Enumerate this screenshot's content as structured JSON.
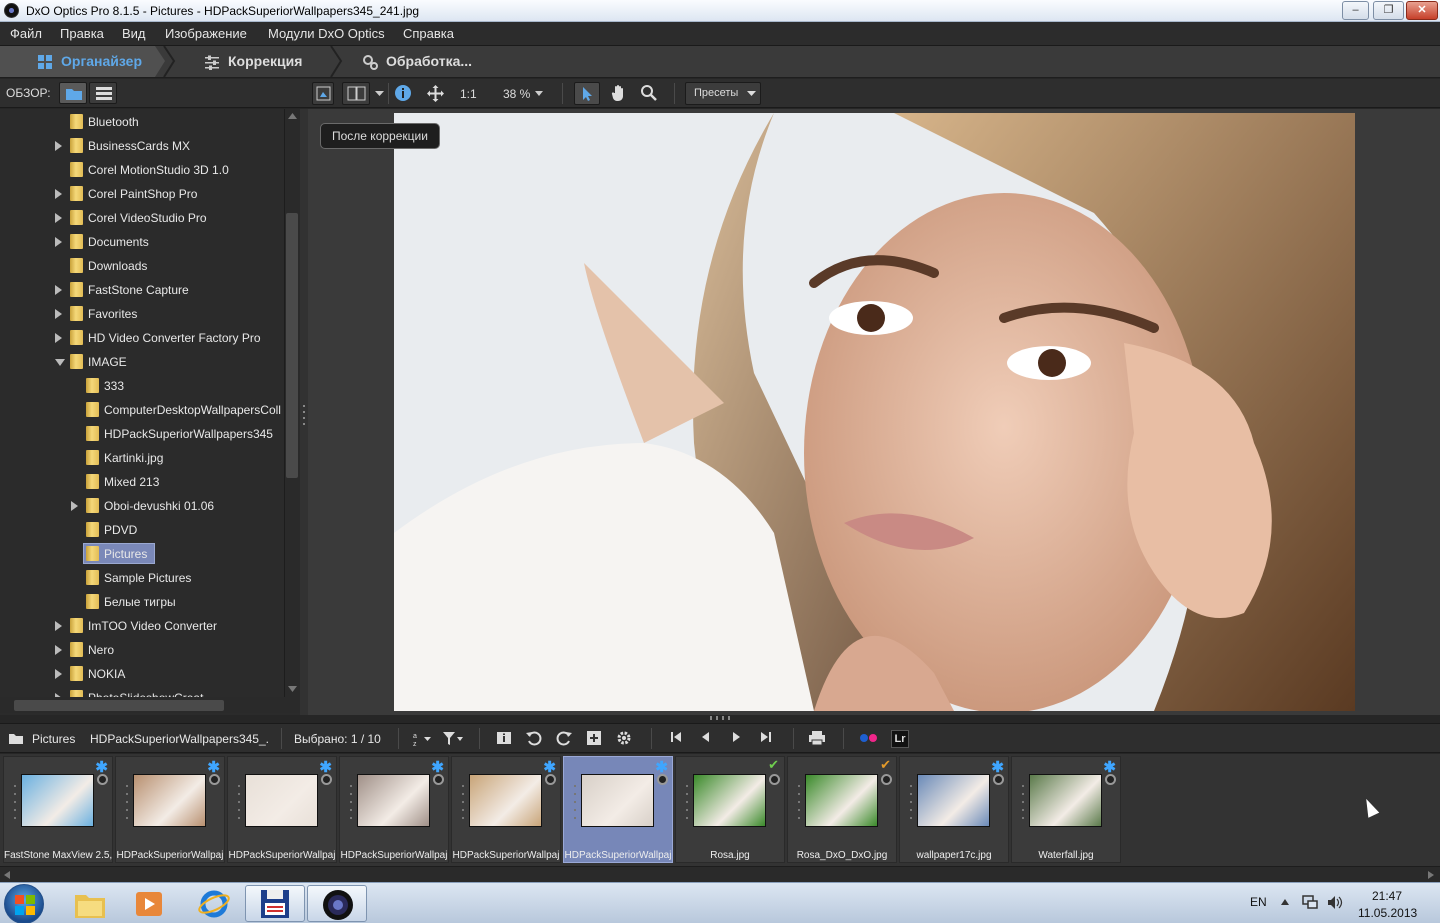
{
  "window": {
    "title": "DxO Optics Pro 8.1.5 - Pictures - HDPackSuperiorWallpapers345_241.jpg",
    "min": "–",
    "max": "❐",
    "close": "✕"
  },
  "menu": [
    "Файл",
    "Правка",
    "Вид",
    "Изображение",
    "Модули DxO Optics",
    "Справка"
  ],
  "tabs": {
    "organizer": "Органайзер",
    "correction": "Коррекция",
    "processing": "Обработка..."
  },
  "browse_label": "ОБЗОР:",
  "viewbar": {
    "one_to_one": "1:1",
    "zoom": "38 %",
    "presets": "Пресеты"
  },
  "tooltip": "После коррекции",
  "tree": [
    {
      "label": "Bluetooth",
      "level": 0,
      "arrow": "none"
    },
    {
      "label": "BusinessCards MX",
      "level": 0,
      "arrow": "right"
    },
    {
      "label": "Corel MotionStudio 3D 1.0",
      "level": 0,
      "arrow": "none"
    },
    {
      "label": "Corel PaintShop Pro",
      "level": 0,
      "arrow": "right"
    },
    {
      "label": "Corel VideoStudio Pro",
      "level": 0,
      "arrow": "right"
    },
    {
      "label": "Documents",
      "level": 0,
      "arrow": "right"
    },
    {
      "label": "Downloads",
      "level": 0,
      "arrow": "none"
    },
    {
      "label": "FastStone Capture",
      "level": 0,
      "arrow": "right"
    },
    {
      "label": "Favorites",
      "level": 0,
      "arrow": "right"
    },
    {
      "label": "HD Video Converter Factory Pro",
      "level": 0,
      "arrow": "right"
    },
    {
      "label": "IMAGE",
      "level": 0,
      "arrow": "down"
    },
    {
      "label": "333",
      "level": 1,
      "arrow": "none"
    },
    {
      "label": "ComputerDesktopWallpapersColl",
      "level": 1,
      "arrow": "none"
    },
    {
      "label": "HDPackSuperiorWallpapers345",
      "level": 1,
      "arrow": "none"
    },
    {
      "label": "Kartinki.jpg",
      "level": 1,
      "arrow": "none"
    },
    {
      "label": "Mixed 213",
      "level": 1,
      "arrow": "none"
    },
    {
      "label": "Oboi-devushki 01.06",
      "level": 1,
      "arrow": "right"
    },
    {
      "label": "PDVD",
      "level": 1,
      "arrow": "none"
    },
    {
      "label": "Pictures",
      "level": 1,
      "arrow": "none",
      "selected": true
    },
    {
      "label": "Sample Pictures",
      "level": 1,
      "arrow": "none"
    },
    {
      "label": "Белые тигры",
      "level": 1,
      "arrow": "none"
    },
    {
      "label": "ImTOO Video Converter",
      "level": 0,
      "arrow": "right"
    },
    {
      "label": "Nero",
      "level": 0,
      "arrow": "right"
    },
    {
      "label": "NOKIA",
      "level": 0,
      "arrow": "right"
    },
    {
      "label": "PhotoSlideshowCreat",
      "level": 0,
      "arrow": "right"
    }
  ],
  "stripbar": {
    "folder": "Pictures",
    "file": "HDPackSuperiorWallpapers345_.",
    "selected": "Выбрано: 1 / 10",
    "lr": "Lr"
  },
  "thumbs": [
    {
      "caption": "FastStone MaxView 2.5,",
      "badge": "star",
      "img": "#6ab0e0"
    },
    {
      "caption": "HDPackSuperiorWallpaj",
      "badge": "star",
      "img": "#b89070"
    },
    {
      "caption": "HDPackSuperiorWallpaj",
      "badge": "star",
      "img": "#e8e0d8"
    },
    {
      "caption": "HDPackSuperiorWallpaj",
      "badge": "star",
      "img": "#a09088"
    },
    {
      "caption": "HDPackSuperiorWallpaj",
      "badge": "star",
      "img": "#c8a478"
    },
    {
      "caption": "HDPackSuperiorWallpaj",
      "badge": "star",
      "img": "#d8d0c8",
      "selected": true
    },
    {
      "caption": "Rosa.jpg",
      "badge": "check",
      "img": "#3a8a2a"
    },
    {
      "caption": "Rosa_DxO_DxO.jpg",
      "badge": "check-orange",
      "img": "#3a8a2a"
    },
    {
      "caption": "wallpaper17c.jpg",
      "badge": "star",
      "img": "#6a8ab8"
    },
    {
      "caption": "Waterfall.jpg",
      "badge": "star",
      "img": "#5a7a4a"
    }
  ],
  "taskbar": {
    "lang": "EN",
    "time": "21:47",
    "date": "11.05.2013"
  }
}
